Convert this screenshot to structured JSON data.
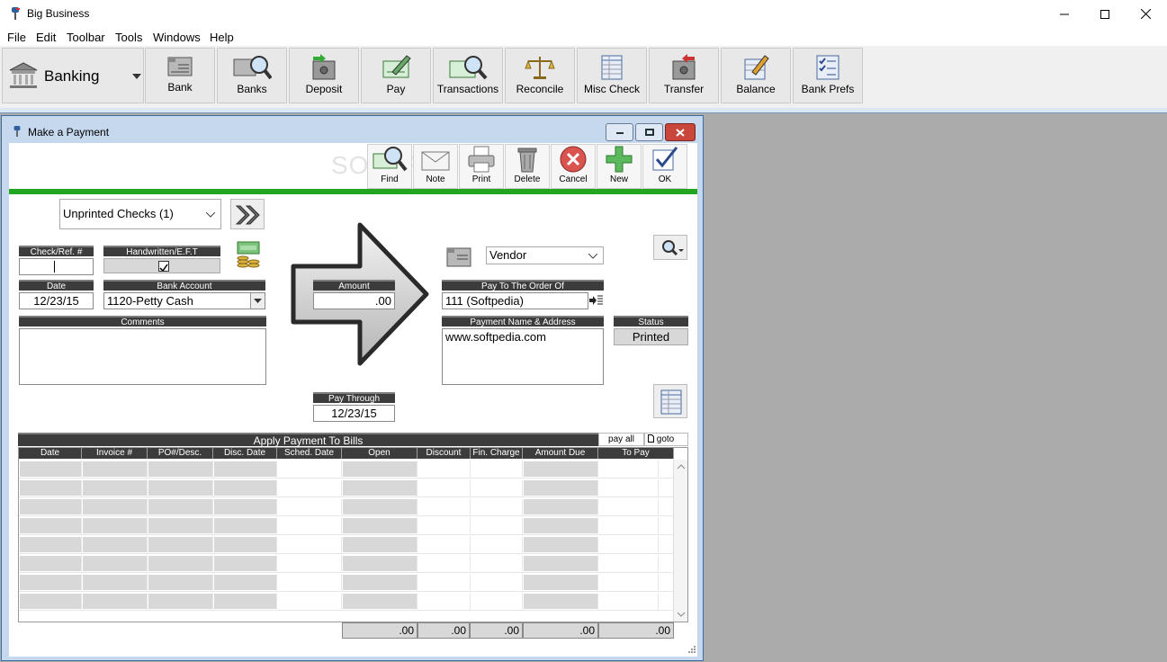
{
  "app": {
    "title": "Big Business"
  },
  "menu": [
    "File",
    "Edit",
    "Toolbar",
    "Tools",
    "Windows",
    "Help"
  ],
  "module": {
    "label": "Banking"
  },
  "toolbar": [
    {
      "label": "Bank",
      "icon": "bank-card-icon"
    },
    {
      "label": "Banks",
      "icon": "banks-search-icon"
    },
    {
      "label": "Deposit",
      "icon": "deposit-safe-icon"
    },
    {
      "label": "Pay",
      "icon": "pay-pen-icon"
    },
    {
      "label": "Transactions",
      "icon": "transactions-icon"
    },
    {
      "label": "Reconcile",
      "icon": "scale-icon"
    },
    {
      "label": "Misc Check",
      "icon": "misc-check-icon"
    },
    {
      "label": "Transfer",
      "icon": "transfer-safe-icon"
    },
    {
      "label": "Balance",
      "icon": "balance-icon"
    },
    {
      "label": "Bank Prefs",
      "icon": "prefs-checklist-icon"
    }
  ],
  "child": {
    "title": "Make a Payment"
  },
  "actions": [
    {
      "label": "Find"
    },
    {
      "label": "Note"
    },
    {
      "label": "Print"
    },
    {
      "label": "Delete"
    },
    {
      "label": "Cancel"
    },
    {
      "label": "New"
    },
    {
      "label": "OK"
    }
  ],
  "form": {
    "filter": "Unprinted Checks  (1)",
    "check_ref_label": "Check/Ref. #",
    "check_ref_value": "",
    "handwritten_label": "Handwritten/E.F.T",
    "handwritten_checked": true,
    "date_label": "Date",
    "date_value": "12/23/15",
    "bank_account_label": "Bank Account",
    "bank_account_value": "1120-Petty Cash",
    "comments_label": "Comments",
    "comments_value": "",
    "amount_label": "Amount",
    "amount_value": ".00",
    "pay_through_label": "Pay Through",
    "pay_through_value": "12/23/15",
    "payee_type": "Vendor",
    "pay_to_label": "Pay To The Order Of",
    "pay_to_value": "111 (Softpedia)",
    "payment_name_label": "Payment Name & Address",
    "payment_name_value": "www.softpedia.com",
    "status_label": "Status",
    "status_value": "Printed"
  },
  "bills": {
    "title": "Apply Payment To Bills",
    "pay_all": "pay all",
    "goto": "goto",
    "columns": [
      "Date",
      "Invoice #",
      "PO#/Desc.",
      "Disc. Date",
      "Sched. Date",
      "Open",
      "Discount",
      "Fin. Charge",
      "Amount Due",
      "To Pay"
    ],
    "totals": {
      "open": ".00",
      "discount": ".00",
      "fin_charge": ".00",
      "amount_due": ".00",
      "to_pay": ".00"
    }
  },
  "watermark": "SOFTPEDIA"
}
